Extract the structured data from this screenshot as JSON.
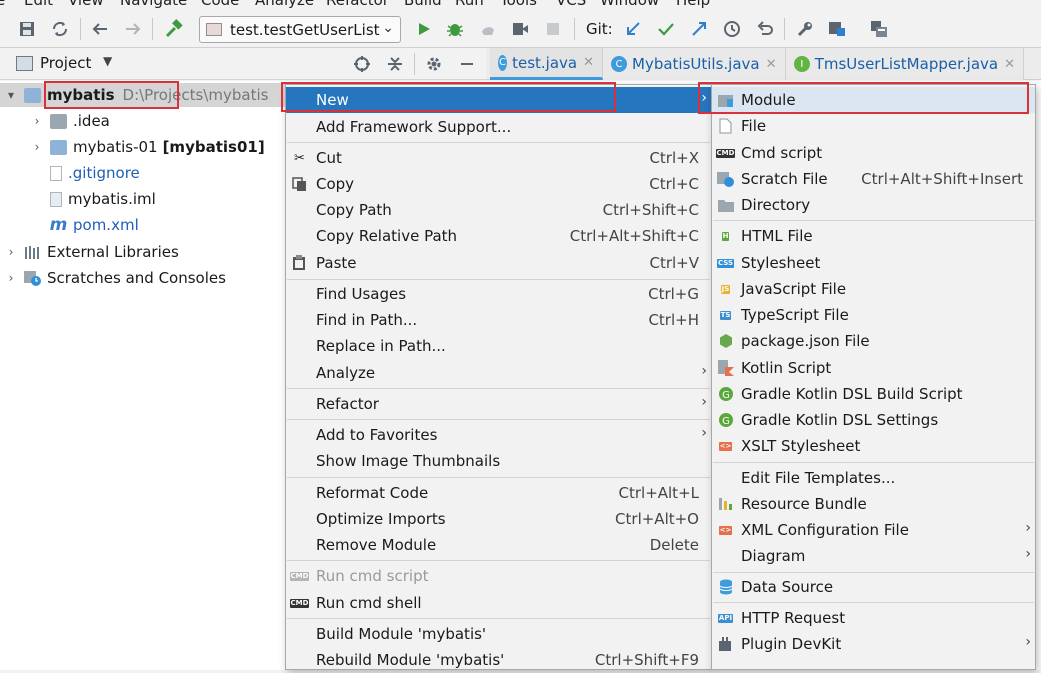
{
  "menubar": [
    "Edit",
    "View",
    "Navigate",
    "Code",
    "Analyze",
    "Refactor",
    "Build",
    "Run",
    "Tools",
    "VCS",
    "Window",
    "Help"
  ],
  "toolbar": {
    "run_config": "test.testGetUserList",
    "git_label": "Git:"
  },
  "project_panel": {
    "title": "Project",
    "tree": [
      {
        "label": "mybatis",
        "hint": "D:\\Projects\\mybatis"
      },
      {
        "label": ".idea"
      },
      {
        "label": "mybatis-01",
        "hint": "[mybatis01]"
      },
      {
        "label": ".gitignore"
      },
      {
        "label": "mybatis.iml"
      },
      {
        "label": "pom.xml"
      },
      {
        "label": "External Libraries"
      },
      {
        "label": "Scratches and Consoles"
      }
    ]
  },
  "tabs": [
    {
      "label": "test.java",
      "icon": "C"
    },
    {
      "label": "MybatisUtils.java",
      "icon": "C"
    },
    {
      "label": "TmsUserListMapper.java",
      "icon": "I"
    }
  ],
  "context_menu": [
    {
      "label": "New",
      "shortcut": "",
      "submenu": true,
      "selected": true
    },
    {
      "label": "Add Framework Support...",
      "shortcut": ""
    },
    {
      "label": "Cut",
      "shortcut": "Ctrl+X",
      "icon": "scissors-icon"
    },
    {
      "label": "Copy",
      "shortcut": "Ctrl+C",
      "icon": "copy-icon"
    },
    {
      "label": "Copy Path",
      "shortcut": "Ctrl+Shift+C"
    },
    {
      "label": "Copy Relative Path",
      "shortcut": "Ctrl+Alt+Shift+C"
    },
    {
      "label": "Paste",
      "shortcut": "Ctrl+V",
      "icon": "paste-icon"
    },
    {
      "label": "Find Usages",
      "shortcut": "Ctrl+G"
    },
    {
      "label": "Find in Path...",
      "shortcut": "Ctrl+H"
    },
    {
      "label": "Replace in Path...",
      "shortcut": ""
    },
    {
      "label": "Analyze",
      "shortcut": "",
      "submenu": true
    },
    {
      "label": "Refactor",
      "shortcut": "",
      "submenu": true
    },
    {
      "label": "Add to Favorites",
      "shortcut": "",
      "submenu": true
    },
    {
      "label": "Show Image Thumbnails",
      "shortcut": ""
    },
    {
      "label": "Reformat Code",
      "shortcut": "Ctrl+Alt+L"
    },
    {
      "label": "Optimize Imports",
      "shortcut": "Ctrl+Alt+O"
    },
    {
      "label": "Remove Module",
      "shortcut": "Delete"
    },
    {
      "label": "Run cmd script",
      "shortcut": "",
      "disabled": true,
      "icon": "cmd-icon"
    },
    {
      "label": "Run cmd shell",
      "shortcut": "",
      "icon": "cmd-icon"
    },
    {
      "label": "Build Module 'mybatis'",
      "shortcut": ""
    },
    {
      "label": "Rebuild Module 'mybatis'",
      "shortcut": "Ctrl+Shift+F9"
    }
  ],
  "new_submenu": [
    {
      "label": "Module",
      "icon": "module-icon",
      "selected": true
    },
    {
      "label": "File",
      "icon": "file-icon"
    },
    {
      "label": "Cmd script",
      "icon": "cmd-icon"
    },
    {
      "label": "Scratch File",
      "shortcut": "Ctrl+Alt+Shift+Insert",
      "icon": "scratch-file-icon"
    },
    {
      "label": "Directory",
      "icon": "folder-icon"
    },
    {
      "label": "HTML File",
      "icon": "html-file-icon"
    },
    {
      "label": "Stylesheet",
      "icon": "css-file-icon"
    },
    {
      "label": "JavaScript File",
      "icon": "js-file-icon"
    },
    {
      "label": "TypeScript File",
      "icon": "ts-file-icon"
    },
    {
      "label": "package.json File",
      "icon": "nodejs-icon"
    },
    {
      "label": "Kotlin Script",
      "icon": "kotlin-icon"
    },
    {
      "label": "Gradle Kotlin DSL Build Script",
      "icon": "gradle-icon"
    },
    {
      "label": "Gradle Kotlin DSL Settings",
      "icon": "gradle-icon"
    },
    {
      "label": "XSLT Stylesheet",
      "icon": "xslt-icon"
    },
    {
      "label": "Edit File Templates...",
      "icon": ""
    },
    {
      "label": "Resource Bundle",
      "icon": "resource-bundle-icon"
    },
    {
      "label": "XML Configuration File",
      "icon": "xml-icon",
      "submenu": true
    },
    {
      "label": "Diagram",
      "icon": "",
      "submenu": true
    },
    {
      "label": "Data Source",
      "icon": "database-icon"
    },
    {
      "label": "HTTP Request",
      "icon": "api-icon"
    },
    {
      "label": "Plugin DevKit",
      "icon": "plugin-icon",
      "submenu": true
    }
  ],
  "colors": {
    "selection": "#2675bf",
    "highlight_box": "#d9313a"
  }
}
